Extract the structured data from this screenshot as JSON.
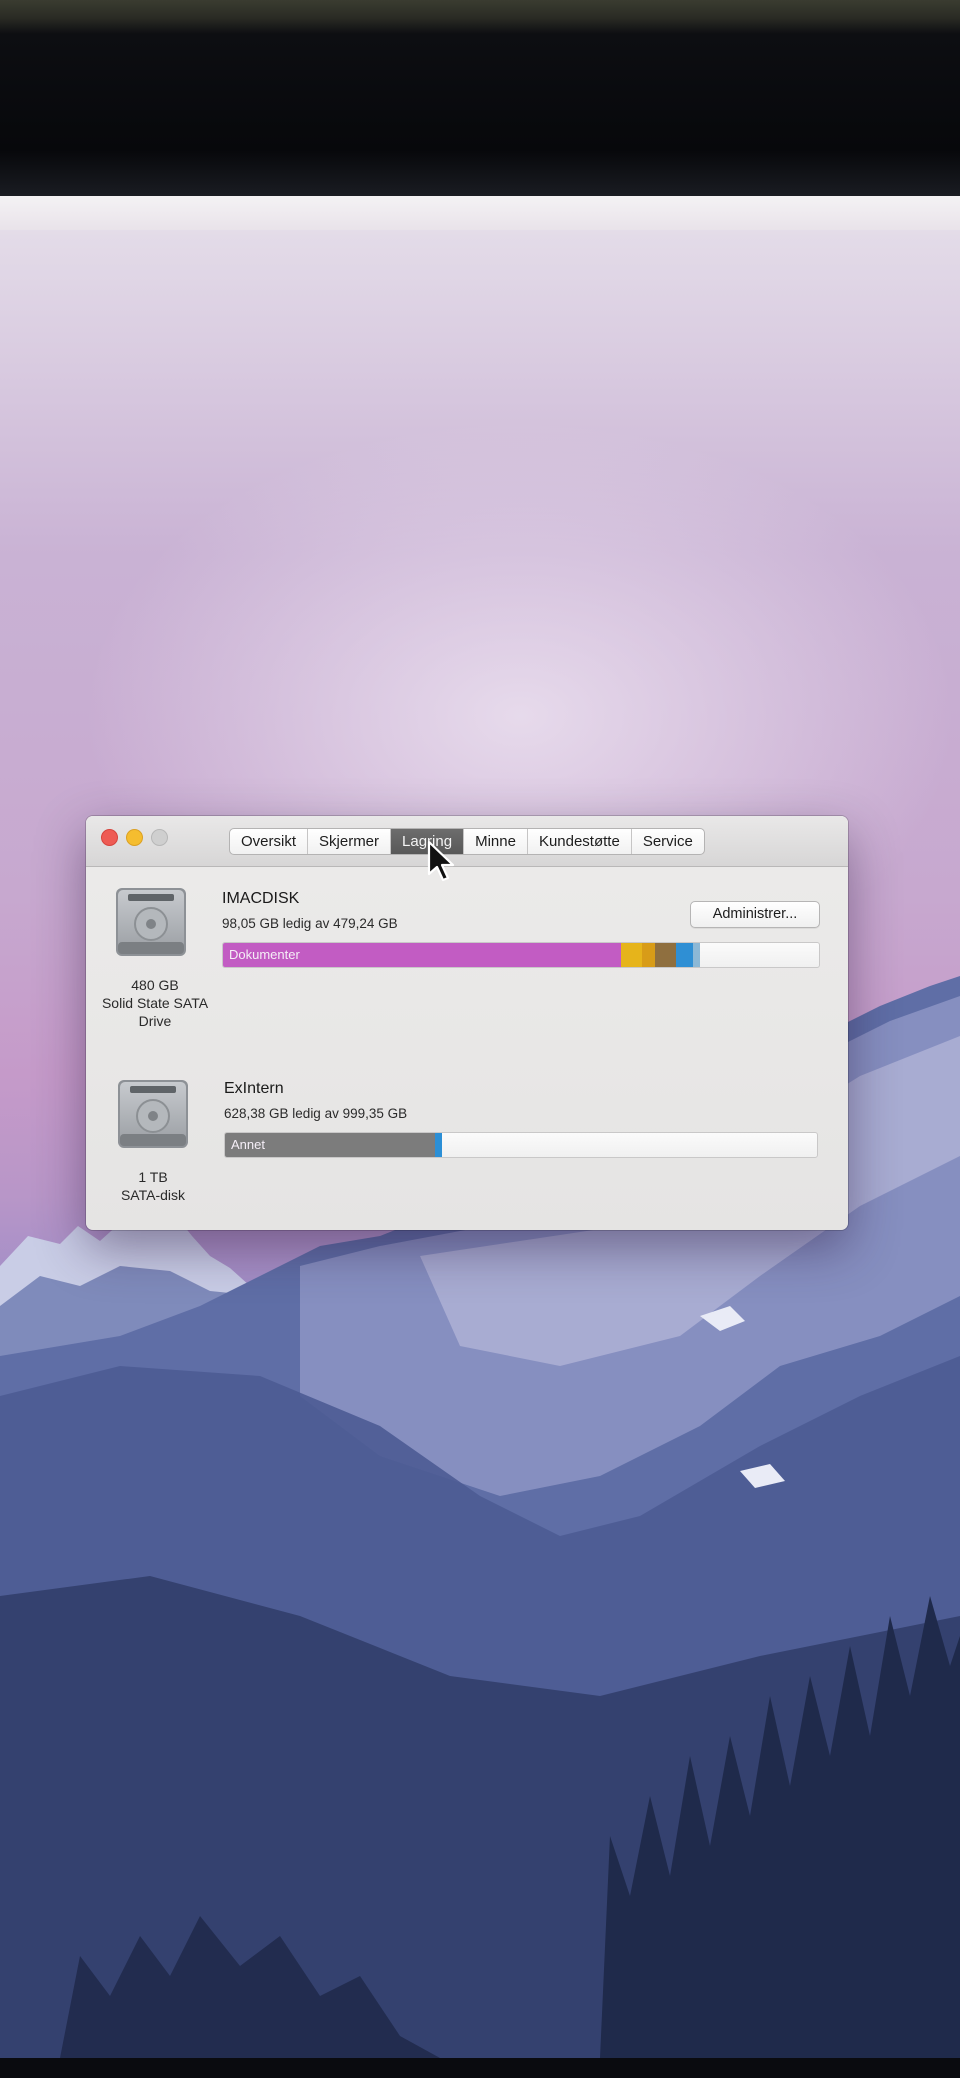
{
  "window": {
    "tabs": [
      "Oversikt",
      "Skjermer",
      "Lagring",
      "Minne",
      "Kundestøtte",
      "Service"
    ],
    "active_tab": "Lagring"
  },
  "manage_button": "Administrer...",
  "drives": [
    {
      "name": "IMACDISK",
      "free_text": "98,05 GB ledig av 479,24 GB",
      "caption_line1": "480 GB",
      "caption_line2": "Solid State SATA",
      "caption_line3": "Drive",
      "bar_label": "Dokumenter",
      "segments": [
        {
          "fraction": 0.667,
          "color": "#c25cc3"
        },
        {
          "fraction": 0.036,
          "color": "#e6b41b"
        },
        {
          "fraction": 0.022,
          "color": "#d89c18"
        },
        {
          "fraction": 0.035,
          "color": "#8f6f3f"
        },
        {
          "fraction": 0.028,
          "color": "#2f8fd4"
        },
        {
          "fraction": 0.013,
          "color": "#8cb8d6"
        }
      ]
    },
    {
      "name": "ExIntern",
      "free_text": "628,38 GB ledig av 999,35 GB",
      "caption_line1": "1 TB",
      "caption_line2": "SATA-disk",
      "bar_label": "Annet",
      "segments": [
        {
          "fraction": 0.355,
          "color": "#7c7c7c"
        },
        {
          "fraction": 0.012,
          "color": "#2b8fd6"
        }
      ]
    }
  ]
}
